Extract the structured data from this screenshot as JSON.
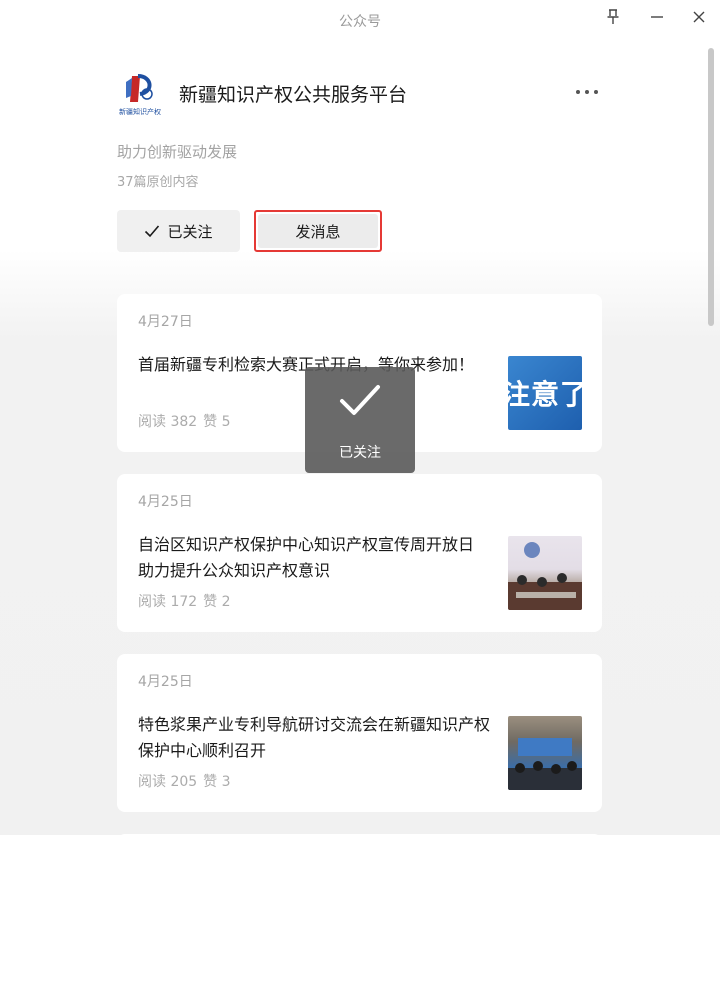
{
  "window": {
    "title": "公众号",
    "controls": [
      "pin-icon",
      "minimize-icon",
      "close-icon"
    ]
  },
  "account": {
    "name": "新疆知识产权公共服务平台",
    "logo_text": "新疆知识产权",
    "signature": "助力创新驱动发展",
    "article_count": "37篇原创内容",
    "more_icon": "more-icon"
  },
  "actions": {
    "followed_label": "已关注",
    "message_label": "发消息"
  },
  "articles": [
    {
      "date": "4月27日",
      "title": "首届新疆专利检索大赛正式开启，等你来参加！",
      "read": "阅读 382",
      "like": "赞 5",
      "thumb_text": "注意了"
    },
    {
      "date": "4月25日",
      "title": "自治区知识产权保护中心知识产权宣传周开放日 助力提升公众知识产权意识",
      "read": "阅读 172",
      "like": "赞 2"
    },
    {
      "date": "4月25日",
      "title": "特色浆果产业专利导航研讨交流会在新疆知识产权保护中心顺利召开",
      "read": "阅读 205",
      "like": "赞 3"
    }
  ],
  "toast": {
    "text": "已关注",
    "icon": "checkmark-icon"
  },
  "colors": {
    "highlight": "#e53935",
    "toast_bg": "#5a5a5a"
  }
}
